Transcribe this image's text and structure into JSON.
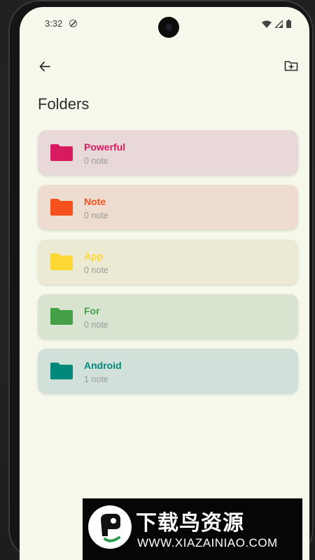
{
  "status_bar": {
    "time": "3:32",
    "icons": [
      "do-not-disturb-icon",
      "wifi-icon",
      "signal-icon",
      "battery-icon"
    ]
  },
  "app_bar": {
    "back_icon": "arrow-left-icon",
    "action_icon": "folder-plus-icon"
  },
  "page": {
    "title": "Folders"
  },
  "folders": [
    {
      "name": "Powerful",
      "count": "0 note",
      "color": "#d81b60",
      "bg": "#e9d8d8"
    },
    {
      "name": "Note",
      "count": "0 note",
      "color": "#f4511e",
      "bg": "#eddccf"
    },
    {
      "name": "App",
      "count": "0 note",
      "color": "#fdd835",
      "bg": "#ecead3"
    },
    {
      "name": "For",
      "count": "0 note",
      "color": "#43a047",
      "bg": "#d8e3d0"
    },
    {
      "name": "Android",
      "count": "1 note",
      "color": "#00897b",
      "bg": "#d2e0da"
    }
  ],
  "watermark": {
    "brand": "下载鸟资源",
    "url": "WWW.XIAZAINIAO.COM"
  },
  "colors": {
    "screen_bg": "#f6f8ec",
    "title_text": "#2b2b2b",
    "secondary_text": "#9a9a9a"
  }
}
